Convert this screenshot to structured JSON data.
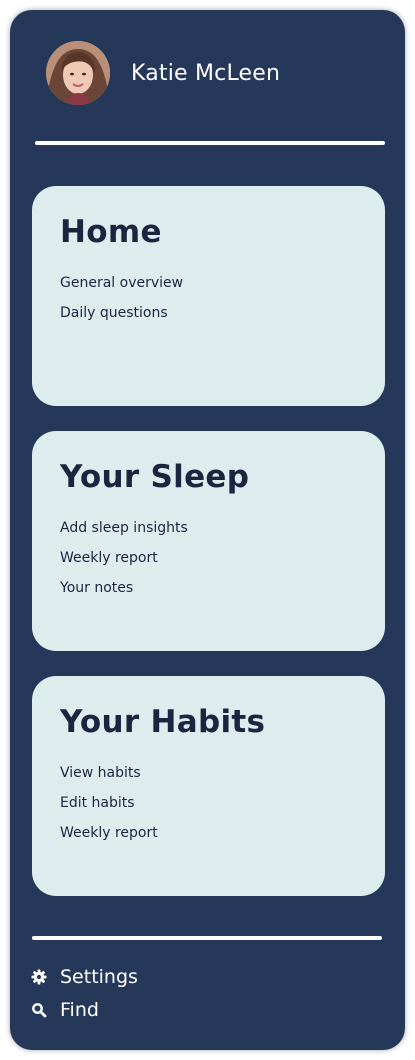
{
  "user": {
    "name": "Katie McLeen"
  },
  "cards": [
    {
      "title": "Home",
      "links": [
        "General overview",
        "Daily questions"
      ]
    },
    {
      "title": "Your Sleep",
      "links": [
        "Add sleep insights",
        "Weekly report",
        "Your notes"
      ]
    },
    {
      "title": "Your Habits",
      "links": [
        "View habits",
        "Edit habits",
        "Weekly report"
      ]
    }
  ],
  "footer": {
    "settings_label": "Settings",
    "settings_icon": "gear-icon",
    "find_label": "Find",
    "find_icon": "search-icon"
  },
  "colors": {
    "panel_bg": "#26385a",
    "card_bg": "#ddedee",
    "card_text": "#1a2540",
    "divider": "#ffffff"
  }
}
